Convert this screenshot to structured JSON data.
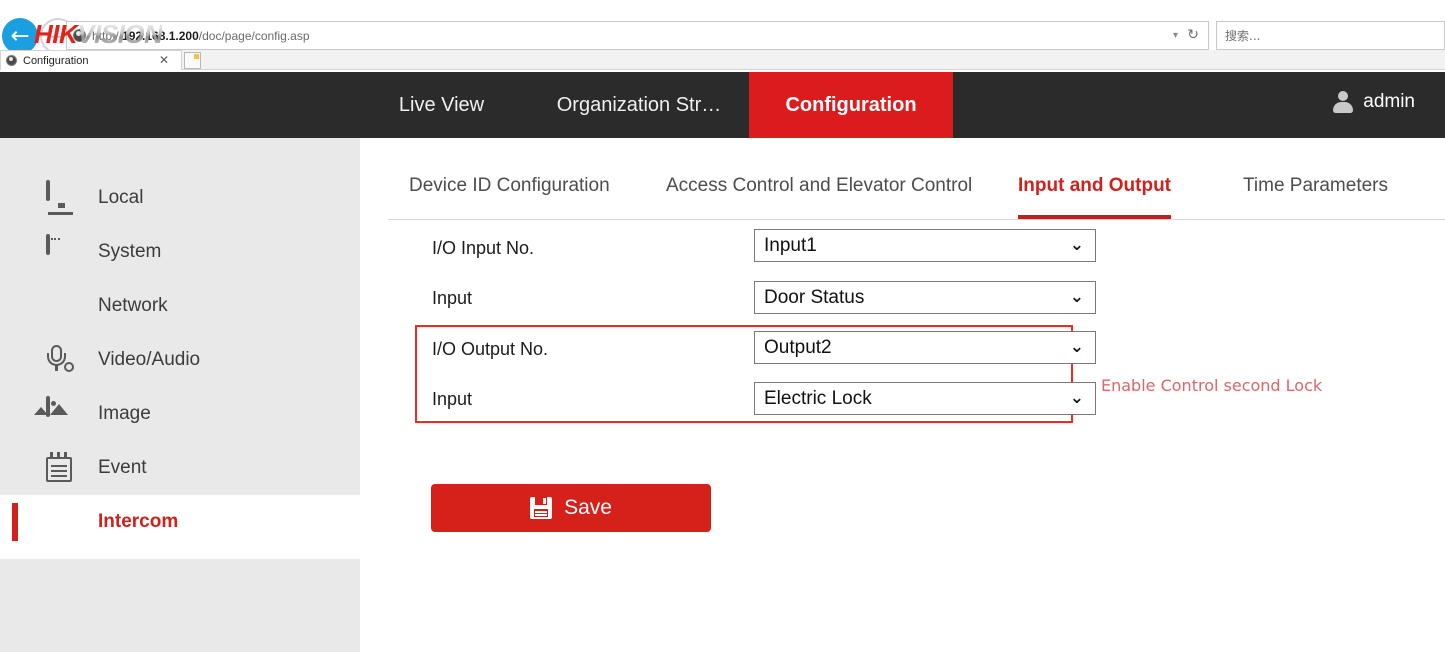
{
  "browser": {
    "back_icon": "back-arrow-icon",
    "forward_icon": "forward-arrow-icon",
    "url_prefix": "http://",
    "url_host": "192.168.1.200",
    "url_path": "/doc/page/config.asp",
    "url_full": "http://192.168.1.200/doc/page/config.asp",
    "dropdown_glyph": "▾",
    "reload_glyph": "↻",
    "search_placeholder": "搜索...",
    "tab_title": "Configuration",
    "tab_close_glyph": "✕"
  },
  "header": {
    "logo_hik": "HIK",
    "logo_vision": "VISION",
    "nav": [
      {
        "label": "Live View",
        "active": false
      },
      {
        "label": "Organization Str…",
        "active": false
      },
      {
        "label": "Configuration",
        "active": true
      }
    ],
    "user_name": "admin",
    "accent_color": "#dc1c1c"
  },
  "sidebar": {
    "items": [
      {
        "label": "Local",
        "icon": "monitor-icon",
        "active": false
      },
      {
        "label": "System",
        "icon": "window-icon",
        "active": false
      },
      {
        "label": "Network",
        "icon": "globe-icon",
        "active": false
      },
      {
        "label": "Video/Audio",
        "icon": "microphone-icon",
        "active": false
      },
      {
        "label": "Image",
        "icon": "picture-icon",
        "active": false
      },
      {
        "label": "Event",
        "icon": "notepad-icon",
        "active": false
      },
      {
        "label": "Intercom",
        "icon": "intercom-device-icon",
        "active": true
      }
    ],
    "active_color": "#d0211c"
  },
  "main": {
    "tabs": [
      {
        "label": "Device ID Configuration",
        "active": false
      },
      {
        "label": "Access Control and Elevator Control",
        "active": false
      },
      {
        "label": "Input and Output",
        "active": true
      },
      {
        "label": "Time Parameters",
        "active": false
      }
    ],
    "form": {
      "io_input_no": {
        "label": "I/O Input No.",
        "value": "Input1",
        "arrow_glyph": "⌄"
      },
      "input_1": {
        "label": "Input",
        "value": "Door Status",
        "arrow_glyph": "⌄"
      },
      "io_output_no": {
        "label": "I/O Output No.",
        "value": "Output2",
        "arrow_glyph": "⌄"
      },
      "input_2": {
        "label": "Input",
        "value": "Electric Lock",
        "arrow_glyph": "⌄"
      }
    },
    "annotation": {
      "note": "Enable Control second Lock",
      "note_color": "#e06565",
      "box_color": "#ee2a24"
    },
    "save": {
      "label": "Save",
      "icon": "floppy-disk-icon",
      "color": "#d6211b"
    }
  }
}
